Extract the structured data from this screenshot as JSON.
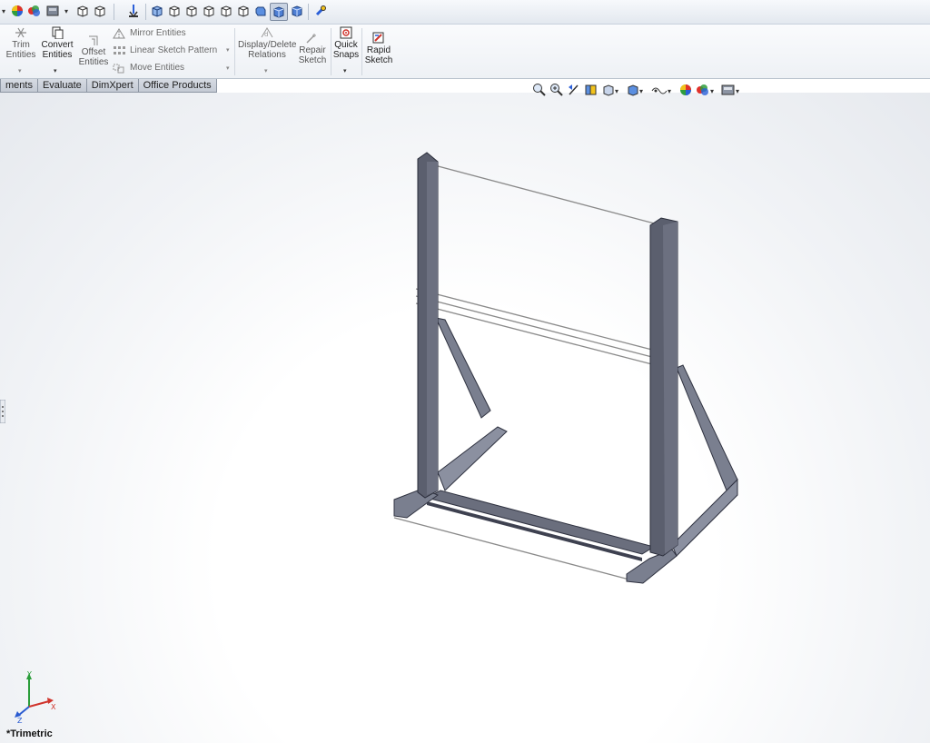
{
  "toolbar": {
    "icons": [
      "chevron-down-icon",
      "appearance-icon",
      "scene-icon",
      "display-style-icon",
      "view-orientation-icon",
      "section-view-icon",
      "normal-to-icon",
      "isometric-icon",
      "trimetric-icon",
      "dimetric-icon",
      "front-view-icon",
      "back-view-icon",
      "left-view-icon",
      "right-view-icon",
      "top-view-icon",
      "bottom-view-icon",
      "pin-icon"
    ]
  },
  "ribbon": {
    "trim": "Trim\nEntities",
    "convert": "Convert\nEntities",
    "offset": "Offset\nEntities",
    "mirror": "Mirror Entities",
    "linear_pattern": "Linear Sketch Pattern",
    "move": "Move Entities",
    "display_delete": "Display/Delete\nRelations",
    "repair": "Repair\nSketch",
    "quick_snaps": "Quick\nSnaps",
    "rapid_sketch": "Rapid\nSketch"
  },
  "tabs": [
    "ments",
    "Evaluate",
    "DimXpert",
    "Office Products"
  ],
  "hud": {
    "icons": [
      "zoom-to-fit-icon",
      "zoom-to-area-icon",
      "previous-view-icon",
      "section-view-icon",
      "view-orientation-icon",
      "display-style-icon",
      "hide-show-items-icon",
      "edit-appearance-icon",
      "apply-scene-icon",
      "view-settings-icon"
    ]
  },
  "viewport": {
    "view_name": "*Trimetric",
    "triad": {
      "x": "X",
      "y": "Y",
      "z": "Z"
    }
  },
  "colors": {
    "steel": "#5b5f6e",
    "steel_light": "#8b90a0",
    "sketch_line": "#8a8a8a",
    "axis_x": "#d0342c",
    "axis_y": "#2a9d3a",
    "axis_z": "#2a5bd0"
  }
}
